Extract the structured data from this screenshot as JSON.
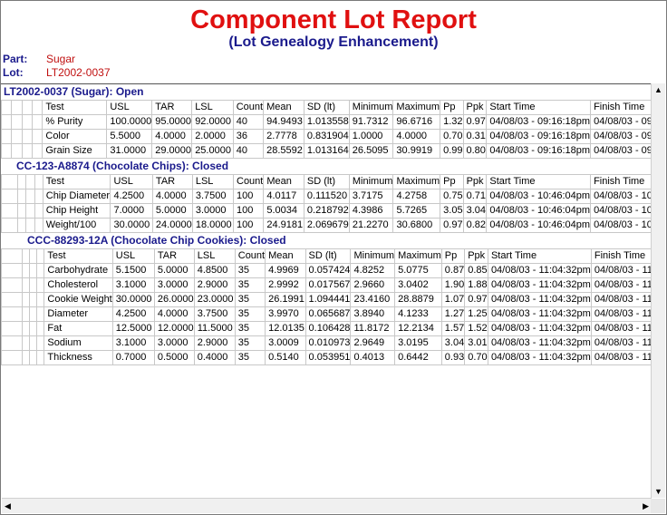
{
  "report": {
    "title": "Component Lot Report",
    "subtitle": "(Lot Genealogy Enhancement)",
    "part_label": "Part:",
    "part_value": "Sugar",
    "lot_label": "Lot:",
    "lot_value": "LT2002-0037"
  },
  "headers": [
    "Test",
    "USL",
    "TAR",
    "LSL",
    "Count",
    "Mean",
    "SD (lt)",
    "Minimum",
    "Maximum",
    "Pp",
    "Ppk",
    "Start Time",
    "Finish Time"
  ],
  "lots": [
    {
      "title": "LT2002-0037 (Sugar): Open",
      "rows": [
        [
          "% Purity",
          "100.0000",
          "95.0000",
          "92.0000",
          "40",
          "94.9493",
          "1.013558",
          "91.7312",
          "96.6716",
          "1.32",
          "0.97",
          "04/08/03 - 09:16:18pm",
          "04/08/03 - 09"
        ],
        [
          "Color",
          "5.5000",
          "4.0000",
          "2.0000",
          "36",
          "2.7778",
          "0.831904",
          "1.0000",
          "4.0000",
          "0.70",
          "0.31",
          "04/08/03 - 09:16:18pm",
          "04/08/03 - 09"
        ],
        [
          "Grain Size",
          "31.0000",
          "29.0000",
          "25.0000",
          "40",
          "28.5592",
          "1.013164",
          "26.5095",
          "30.9919",
          "0.99",
          "0.80",
          "04/08/03 - 09:16:18pm",
          "04/08/03 - 09"
        ]
      ]
    },
    {
      "title": "CC-123-A8874 (Chocolate Chips): Closed",
      "rows": [
        [
          "Chip Diameter",
          "4.2500",
          "4.0000",
          "3.7500",
          "100",
          "4.0117",
          "0.111520",
          "3.7175",
          "4.2758",
          "0.75",
          "0.71",
          "04/08/03 - 10:46:04pm",
          "04/08/03 - 10"
        ],
        [
          "Chip Height",
          "7.0000",
          "5.0000",
          "3.0000",
          "100",
          "5.0034",
          "0.218792",
          "4.3986",
          "5.7265",
          "3.05",
          "3.04",
          "04/08/03 - 10:46:04pm",
          "04/08/03 - 10"
        ],
        [
          "Weight/100",
          "30.0000",
          "24.0000",
          "18.0000",
          "100",
          "24.9181",
          "2.069679",
          "21.2270",
          "30.6800",
          "0.97",
          "0.82",
          "04/08/03 - 10:46:04pm",
          "04/08/03 - 10"
        ]
      ]
    },
    {
      "title": "CCC-88293-12A (Chocolate Chip Cookies): Closed",
      "rows": [
        [
          "Carbohydrate",
          "5.1500",
          "5.0000",
          "4.8500",
          "35",
          "4.9969",
          "0.057424",
          "4.8252",
          "5.0775",
          "0.87",
          "0.85",
          "04/08/03 - 11:04:32pm",
          "04/08/03 - 11"
        ],
        [
          "Cholesterol",
          "3.1000",
          "3.0000",
          "2.9000",
          "35",
          "2.9992",
          "0.017567",
          "2.9660",
          "3.0402",
          "1.90",
          "1.88",
          "04/08/03 - 11:04:32pm",
          "04/08/03 - 11"
        ],
        [
          "Cookie Weight",
          "30.0000",
          "26.0000",
          "23.0000",
          "35",
          "26.1991",
          "1.094441",
          "23.4160",
          "28.8879",
          "1.07",
          "0.97",
          "04/08/03 - 11:04:32pm",
          "04/08/03 - 11"
        ],
        [
          "Diameter",
          "4.2500",
          "4.0000",
          "3.7500",
          "35",
          "3.9970",
          "0.065687",
          "3.8940",
          "4.1233",
          "1.27",
          "1.25",
          "04/08/03 - 11:04:32pm",
          "04/08/03 - 11"
        ],
        [
          "Fat",
          "12.5000",
          "12.0000",
          "11.5000",
          "35",
          "12.0135",
          "0.106428",
          "11.8172",
          "12.2134",
          "1.57",
          "1.52",
          "04/08/03 - 11:04:32pm",
          "04/08/03 - 11"
        ],
        [
          "Sodium",
          "3.1000",
          "3.0000",
          "2.9000",
          "35",
          "3.0009",
          "0.010973",
          "2.9649",
          "3.0195",
          "3.04",
          "3.01",
          "04/08/03 - 11:04:32pm",
          "04/08/03 - 11"
        ],
        [
          "Thickness",
          "0.7000",
          "0.5000",
          "0.4000",
          "35",
          "0.5140",
          "0.053951",
          "0.4013",
          "0.6442",
          "0.93",
          "0.70",
          "04/08/03 - 11:04:32pm",
          "04/08/03 - 11"
        ]
      ]
    }
  ],
  "icons": {
    "scroll_up": "scroll-up-arrow-icon",
    "scroll_down": "scroll-down-arrow-icon",
    "scroll_left": "scroll-left-arrow-icon",
    "scroll_right": "scroll-right-arrow-icon"
  },
  "colors": {
    "title": "#e01010",
    "subtitle": "#1a1a8c",
    "lot_title": "#1a1a8c",
    "value": "#c01010"
  }
}
